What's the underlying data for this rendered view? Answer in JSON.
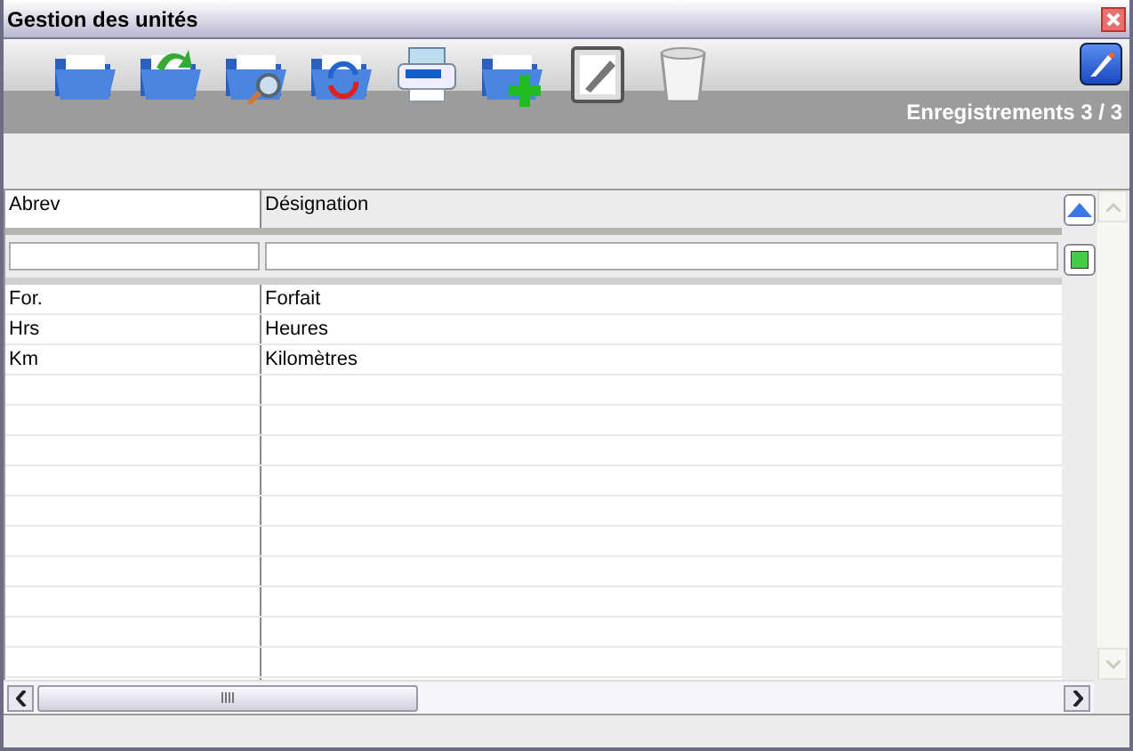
{
  "window": {
    "title": "Gestion des unités"
  },
  "toolbar": {
    "record_counter": "Enregistrements 3 / 3"
  },
  "table": {
    "columns": [
      "Abrev",
      "Désignation"
    ],
    "rows": [
      {
        "cells": [
          "For.",
          "Forfait"
        ]
      },
      {
        "cells": [
          "Hrs",
          "Heures"
        ]
      },
      {
        "cells": [
          "Km",
          "Kilomètres"
        ]
      }
    ]
  }
}
